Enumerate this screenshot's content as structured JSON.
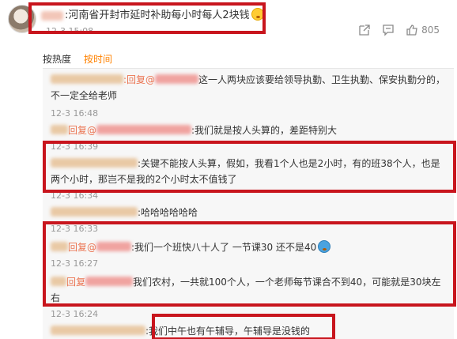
{
  "post": {
    "text": ":河南省开封市延时补助每小时每人2块钱",
    "time": "12-3 15:08",
    "like_count": "805"
  },
  "tabs": {
    "hot": "按热度",
    "time": "按时间"
  },
  "comments": [
    {
      "prefix": "",
      "mention_reply": ":回复@",
      "text": "这一人两块应该要给领导执勤、卫生执勤、保安执勤分的，不一定全给老师",
      "time": "12-3 16:48"
    },
    {
      "prefix": "回复@",
      "text": ":我们就是按人头算的，差距特别大",
      "time": "12-3 16:39"
    },
    {
      "prefix": "",
      "text": ":关键不能按人头算，假如，我看1个人也是2小时，有的班38个人，也是两个小时，那岂不是我的2个小时太不值钱了",
      "time": "12-3 16:34"
    },
    {
      "prefix": "",
      "text": ":哈哈哈哈哈哈",
      "time": "12-3 16:33"
    },
    {
      "prefix": "回复@",
      "text": ":我们一个班快八十人了 一节课30 还不是40",
      "time": "12-3 16:27"
    },
    {
      "prefix": "回复",
      "text": "我们农村，一共就100个人，一个老师每节课合不到40，可能就是30块左右",
      "time": "12-3 16:24"
    },
    {
      "prefix": "",
      "text": ":我们中午也有午辅导，午辅导是没钱的",
      "time": ""
    }
  ]
}
